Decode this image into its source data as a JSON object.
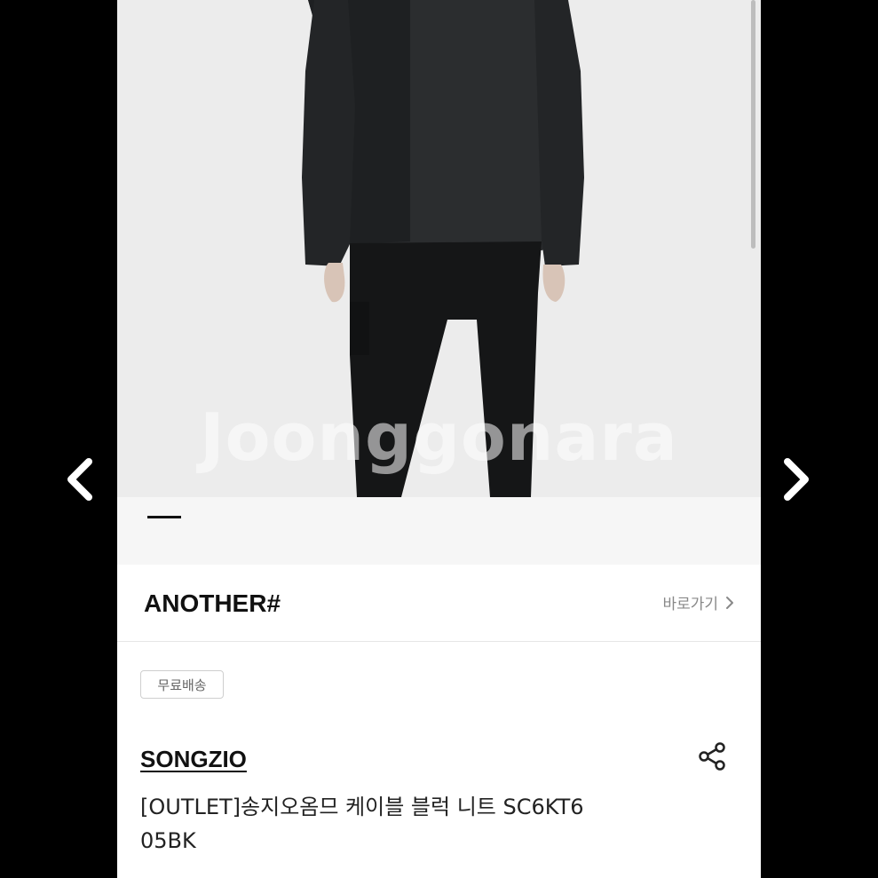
{
  "nav": {
    "prev_icon": "chevron-left-icon",
    "next_icon": "chevron-right-icon"
  },
  "product_image": {
    "watermark": "Joonggonara",
    "background_color": "#ececec",
    "slide_indicator_color": "#111111"
  },
  "shop": {
    "name": "ANOTHER#",
    "goto_label": "바로가기"
  },
  "product": {
    "shipping_badge": "무료배송",
    "brand": "SONGZIO",
    "title_line1": "[OUTLET]송지오옴므 케이블 블럭 니트 SC6KT6",
    "title_line2": "05BK",
    "share_icon": "share-icon"
  }
}
